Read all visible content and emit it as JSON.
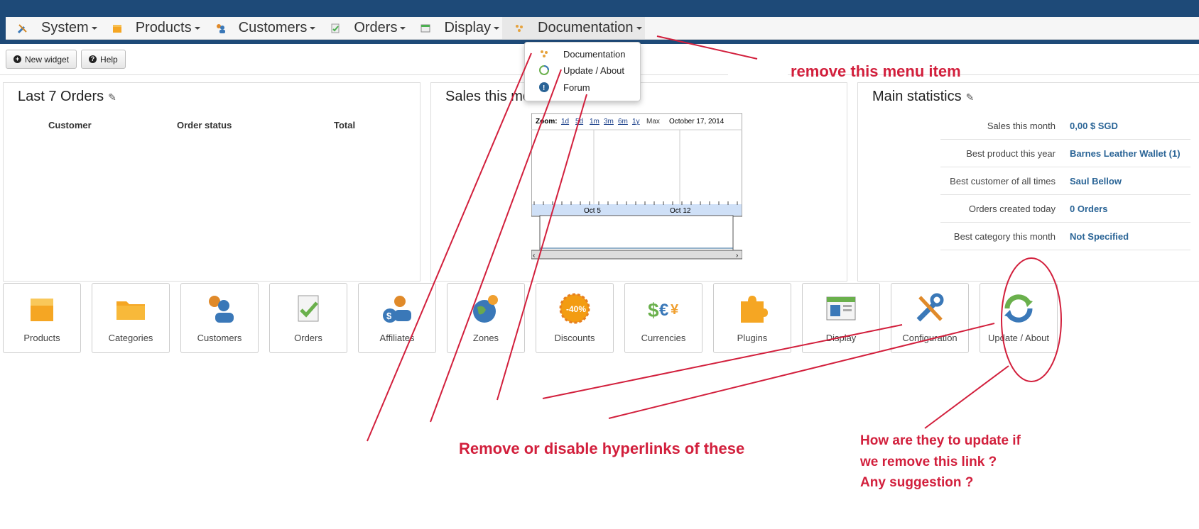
{
  "menu": {
    "items": [
      {
        "label": "System",
        "icon": "tools-icon"
      },
      {
        "label": "Products",
        "icon": "box-icon"
      },
      {
        "label": "Customers",
        "icon": "users-icon"
      },
      {
        "label": "Orders",
        "icon": "orders-icon"
      },
      {
        "label": "Display",
        "icon": "display-icon"
      },
      {
        "label": "Documentation",
        "icon": "documentation-icon"
      }
    ],
    "dropdown": [
      {
        "label": "Documentation",
        "icon": "documentation-icon"
      },
      {
        "label": "Update / About",
        "icon": "update-icon"
      },
      {
        "label": "Forum",
        "icon": "info-icon"
      }
    ]
  },
  "toolbar": {
    "new_widget": "New widget",
    "help": "Help"
  },
  "panels": {
    "orders": {
      "title": "Last 7 Orders",
      "col_customer": "Customer",
      "col_status": "Order status",
      "col_total": "Total"
    },
    "sales": {
      "title": "Sales this month"
    },
    "stats": {
      "title": "Main statistics",
      "rows": [
        {
          "label": "Sales this month",
          "value": "0,00 $ SGD"
        },
        {
          "label": "Best product this year",
          "value": "Barnes Leather Wallet (1)"
        },
        {
          "label": "Best customer of all times",
          "value": "Saul Bellow"
        },
        {
          "label": "Orders created today",
          "value": "0 Orders"
        },
        {
          "label": "Best category this month",
          "value": "Not Specified"
        }
      ]
    }
  },
  "chart_data": {
    "type": "line",
    "zoom_label": "Zoom:",
    "zoom_options": [
      "1d",
      "5d",
      "1m",
      "3m",
      "6m",
      "1y",
      "Max"
    ],
    "date_label": "October 17, 2014",
    "x_ticks": [
      "Oct 5",
      "Oct 12"
    ],
    "series": []
  },
  "tiles": [
    {
      "label": "Products",
      "icon": "box-icon"
    },
    {
      "label": "Categories",
      "icon": "folder-icon"
    },
    {
      "label": "Customers",
      "icon": "users-icon"
    },
    {
      "label": "Orders",
      "icon": "orders-icon"
    },
    {
      "label": "Affiliates",
      "icon": "affiliates-icon"
    },
    {
      "label": "Zones",
      "icon": "globe-icon"
    },
    {
      "label": "Discounts",
      "icon": "discount-icon"
    },
    {
      "label": "Currencies",
      "icon": "currency-icon"
    },
    {
      "label": "Plugins",
      "icon": "puzzle-icon"
    },
    {
      "label": "Display",
      "icon": "display-icon"
    },
    {
      "label": "Configuration",
      "icon": "tools-icon"
    },
    {
      "label": "Update / About",
      "icon": "update-icon"
    }
  ],
  "annotations": {
    "remove_menu": "remove this menu item",
    "remove_links": "Remove or disable hyperlinks of these",
    "question_1": "How are they to update if",
    "question_2": "we remove this link ?",
    "question_3": "Any suggestion ?",
    "discount_badge": "-40%",
    "currency_symbols": "$€¥",
    "color": "#d21f3c"
  },
  "colors": {
    "topbar": "#1e4a78",
    "link": "#2a6496"
  }
}
